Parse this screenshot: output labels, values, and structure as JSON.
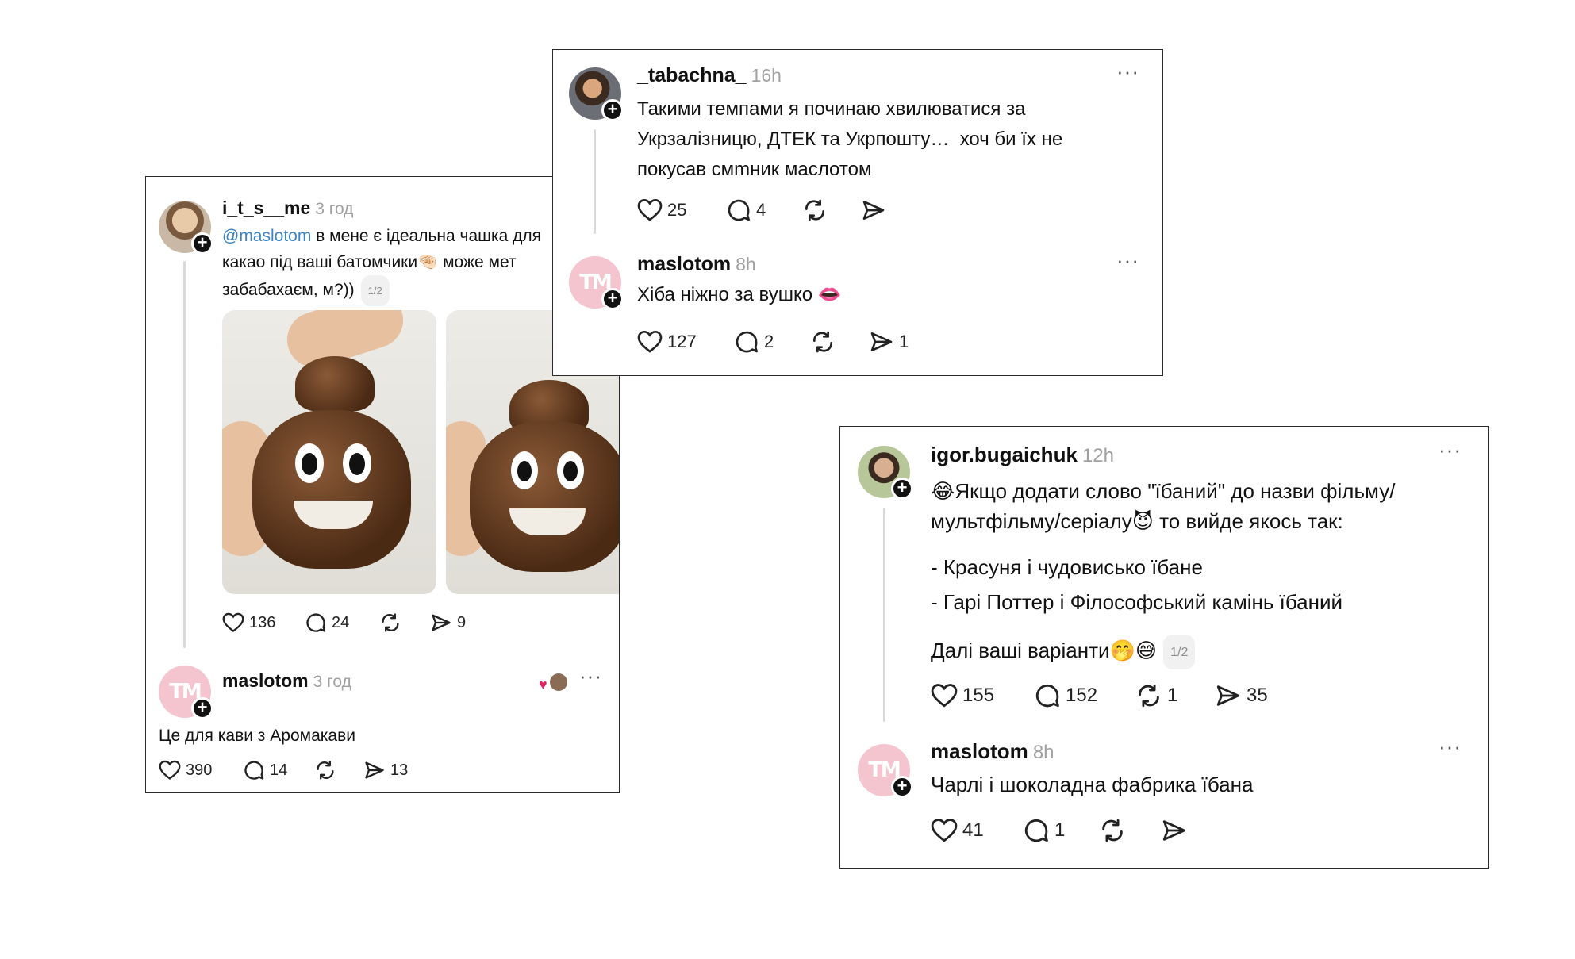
{
  "card1": {
    "post1": {
      "username": "i_t_s__me",
      "time": "3 год",
      "mention": "@maslotom",
      "text": " в мене є ідеальна чашка для\nкакао під ваші батомчики🤏🏻 може мет\nзабабахаєм, м?))",
      "pager": "1/2",
      "likes": "136",
      "comments": "24",
      "reposts": "",
      "shares": "9"
    },
    "post2": {
      "username": "maslotom",
      "time": "3 год",
      "text": "Це для кави з Аромакави",
      "likes": "390",
      "comments": "14",
      "reposts": "",
      "shares": "13"
    }
  },
  "card2": {
    "post1": {
      "username": "_tabachna_",
      "time": "16h",
      "text": "Такими темпами я починаю хвилюватися за\nУкрзалізницю, ДТЕК та Укрпошту…  хоч би їх не\nпокусав смmник маслотом",
      "likes": "25",
      "comments": "4",
      "reposts": "",
      "shares": ""
    },
    "post2": {
      "username": "maslotom",
      "time": "8h",
      "text": "Хіба ніжно за вушко 👄",
      "likes": "127",
      "comments": "2",
      "reposts": "",
      "shares": "1"
    }
  },
  "card3": {
    "post1": {
      "username": "igor.bugaichuk",
      "time": "12h",
      "line1": "😂Якщо додати слово \"їбаний\" до назви фільму/",
      "line2": "мультфільму/серіалу😈 то вийде якось так:",
      "line3": "- Красуня і чудовисько їбане",
      "line4": "- Гарі Поттер і Філософський камінь їбаний",
      "line5": "Далі ваші варіанти🤭😅",
      "pager": "1/2",
      "likes": "155",
      "comments": "152",
      "reposts": "1",
      "shares": "35"
    },
    "post2": {
      "username": "maslotom",
      "time": "8h",
      "text": "Чарлі і шоколадна фабрика їбана",
      "likes": "41",
      "comments": "1",
      "reposts": "",
      "shares": ""
    }
  },
  "brand_mark": "TM",
  "more_glyph": "···",
  "plus_glyph": "+",
  "icons": [
    "heart-icon",
    "comment-icon",
    "repost-icon",
    "share-icon",
    "more-icon",
    "follow-plus-icon"
  ],
  "colors": {
    "mention": "#3b83c4",
    "brand_pink": "#f5c5cf",
    "muted": "#a0a0a0"
  }
}
